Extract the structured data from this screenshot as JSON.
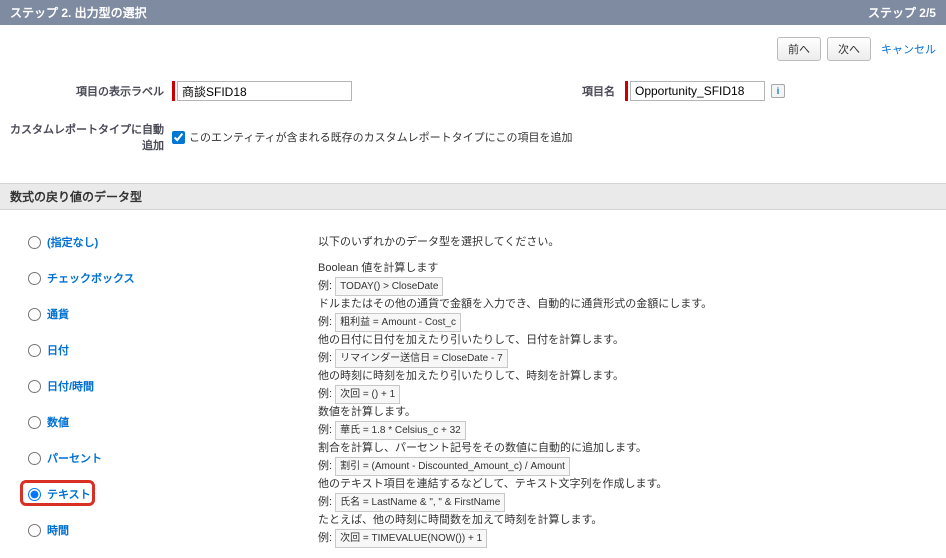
{
  "header": {
    "title": "ステップ 2. 出力型の選択",
    "step_indicator": "ステップ 2/5"
  },
  "nav": {
    "prev": "前へ",
    "next": "次へ",
    "cancel": "キャンセル"
  },
  "fields": {
    "display_label_label": "項目の表示ラベル",
    "display_label_value": "商談SFID18",
    "name_label": "項目名",
    "name_value": "Opportunity_SFID18"
  },
  "auto_add": {
    "label": "カスタムレポートタイプに自動追加",
    "checked": true,
    "text": "このエンティティが含まれる既存のカスタムレポートタイプにこの項目を追加"
  },
  "section_title": "数式の戻り値のデータ型",
  "instruction": "以下のいずれかのデータ型を選択してください。",
  "types": [
    {
      "key": "none",
      "label": "(指定なし)",
      "checked": false
    },
    {
      "key": "checkbox",
      "label": "チェックボックス",
      "checked": false,
      "desc": "Boolean 値を計算します",
      "example": "TODAY() > CloseDate"
    },
    {
      "key": "currency",
      "label": "通貨",
      "checked": false,
      "desc": "ドルまたはその他の通貨で金額を入力でき、自動的に通貨形式の金額にします。",
      "example": "粗利益 = Amount - Cost_c"
    },
    {
      "key": "date",
      "label": "日付",
      "checked": false,
      "desc": "他の日付に日付を加えたり引いたりして、日付を計算します。",
      "example": "リマインダー送信日 = CloseDate - 7"
    },
    {
      "key": "datetime",
      "label": "日付/時間",
      "checked": false,
      "desc": "他の時刻に時刻を加えたり引いたりして、時刻を計算します。",
      "example": "次回 = () + 1"
    },
    {
      "key": "number",
      "label": "数値",
      "checked": false,
      "desc": "数値を計算します。",
      "example": "華氏 = 1.8 * Celsius_c + 32"
    },
    {
      "key": "percent",
      "label": "パーセント",
      "checked": false,
      "desc": "割合を計算し、パーセント記号をその数値に自動的に追加します。",
      "example": "割引 = (Amount - Discounted_Amount_c) / Amount"
    },
    {
      "key": "text",
      "label": "テキスト",
      "checked": true,
      "desc": "他のテキスト項目を連結するなどして、テキスト文字列を作成します。",
      "example": "氏名 = LastName & \", \" & FirstName"
    },
    {
      "key": "time",
      "label": "時間",
      "checked": false,
      "desc": "たとえば、他の時刻に時間数を加えて時刻を計算します。",
      "example": "次回 = TIMEVALUE(NOW()) + 1"
    }
  ],
  "example_prefix": "例:"
}
